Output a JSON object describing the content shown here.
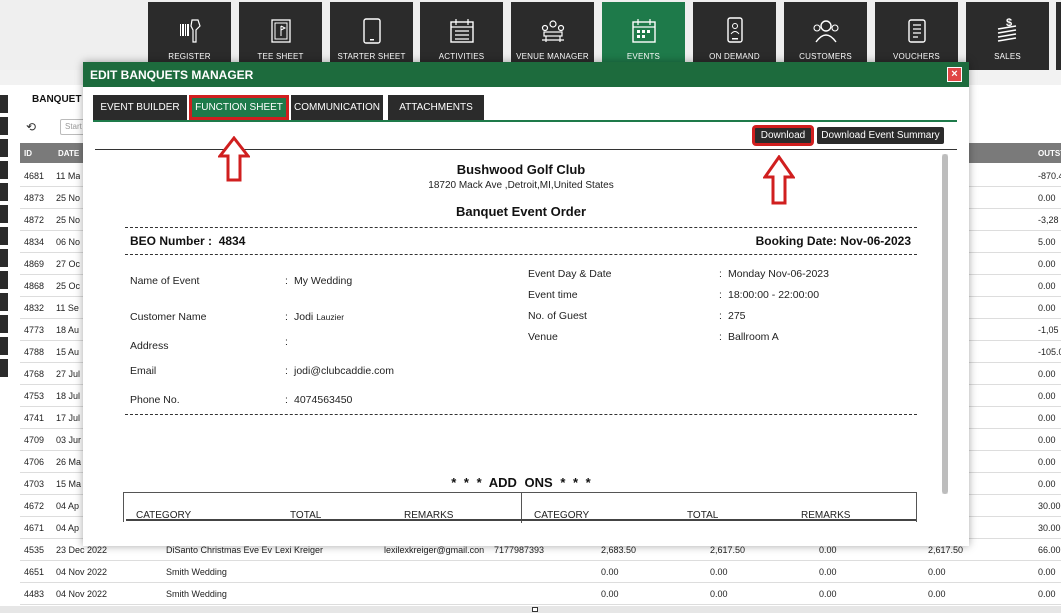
{
  "topnav": {
    "tiles": [
      {
        "label": "REGISTER",
        "icon": "barcode-scanner-icon"
      },
      {
        "label": "TEE SHEET",
        "icon": "tee-sheet-icon"
      },
      {
        "label": "STARTER SHEET",
        "icon": "tablet-icon"
      },
      {
        "label": "ACTIVITIES",
        "icon": "calendar-icon"
      },
      {
        "label": "VENUE MANAGER",
        "icon": "venue-icon"
      },
      {
        "label": "EVENTS",
        "icon": "events-calendar-icon"
      },
      {
        "label": "ON DEMAND",
        "icon": "phone-icon"
      },
      {
        "label": "CUSTOMERS",
        "icon": "customers-icon"
      },
      {
        "label": "VOUCHERS",
        "icon": "voucher-icon"
      },
      {
        "label": "SALES",
        "icon": "sales-icon"
      }
    ],
    "active_color": "#1e7a4a"
  },
  "background": {
    "title": "BANQUET",
    "search_placeholder": "Start",
    "columns": {
      "id": "ID",
      "date": "DATE",
      "outstanding": "OUTST"
    },
    "rows": [
      {
        "id": "4681",
        "date": "11 Ma",
        "out": "-870.4"
      },
      {
        "id": "4873",
        "date": "25 No",
        "out": "0.00"
      },
      {
        "id": "4872",
        "date": "25 No",
        "out": "-3,28"
      },
      {
        "id": "4834",
        "date": "06 No",
        "out": "5.00"
      },
      {
        "id": "4869",
        "date": "27 Oc",
        "out": "0.00"
      },
      {
        "id": "4868",
        "date": "25 Oc",
        "out": "0.00"
      },
      {
        "id": "4832",
        "date": "11 Se",
        "out": "0.00"
      },
      {
        "id": "4773",
        "date": "18 Au",
        "out": "-1,05"
      },
      {
        "id": "4788",
        "date": "15 Au",
        "out": "-105.0"
      },
      {
        "id": "4768",
        "date": "27 Jul",
        "out": "0.00"
      },
      {
        "id": "4753",
        "date": "18 Jul",
        "out": "0.00"
      },
      {
        "id": "4741",
        "date": "17 Jul",
        "out": "0.00"
      },
      {
        "id": "4709",
        "date": "03 Jur",
        "out": "0.00"
      },
      {
        "id": "4706",
        "date": "26 Ma",
        "out": "0.00"
      },
      {
        "id": "4703",
        "date": "15 Ma",
        "out": "0.00"
      },
      {
        "id": "4672",
        "date": "04 Ap",
        "out": "30.00"
      },
      {
        "id": "4671",
        "date": "04 Ap",
        "out": "30.00"
      }
    ],
    "full_rows": [
      {
        "id": "4535",
        "date": "23 Dec 2022",
        "event": "DiSanto Christmas Eve Ev",
        "customer": "Lexi Kreiger",
        "email": "lexilexkreiger@gmail.con",
        "phone": "7177987393",
        "c1": "2,683.50",
        "c2": "2,617.50",
        "c3": "0.00",
        "c4": "2,617.50",
        "out": "66.00"
      },
      {
        "id": "4651",
        "date": "04 Nov 2022",
        "event": "Smith Wedding",
        "customer": "",
        "email": "",
        "phone": "",
        "c1": "0.00",
        "c2": "0.00",
        "c3": "0.00",
        "c4": "0.00",
        "out": "0.00"
      },
      {
        "id": "4483",
        "date": "04 Nov 2022",
        "event": "Smith Wedding",
        "customer": "",
        "email": "",
        "phone": "",
        "c1": "0.00",
        "c2": "0.00",
        "c3": "0.00",
        "c4": "0.00",
        "out": "0.00"
      }
    ]
  },
  "modal": {
    "title": "EDIT BANQUETS MANAGER",
    "close": "×",
    "tabs": [
      "EVENT BUILDER",
      "FUNCTION SHEET",
      "COMMUNICATION",
      "ATTACHMENTS"
    ],
    "active_tab": "FUNCTION SHEET",
    "download_label": "Download",
    "download_summary_label": "Download Event Summary",
    "highlight_color": "#d01f1f"
  },
  "document": {
    "club_name": "Bushwood Golf Club",
    "club_address": "18720 Mack Ave ,Detroit,MI,United States",
    "heading": "Banquet Event Order",
    "beo_label": "BEO Number :",
    "beo_number": "4834",
    "booking_label": "Booking Date:",
    "booking_date": "Nov-06-2023",
    "left_fields": {
      "event_name_label": "Name of Event",
      "event_name": "My Wedding",
      "customer_label": "Customer Name",
      "customer_first": "Jodi",
      "customer_last": "Lauzier",
      "address_label": "Address",
      "address": "",
      "email_label": "Email",
      "email": "jodi@clubcaddie.com",
      "phone_label": "Phone No.",
      "phone": "4074563450"
    },
    "right_fields": {
      "day_label": "Event Day & Date",
      "day": "Monday Nov-06-2023",
      "time_label": "Event time",
      "time": "18:00:00 - 22:00:00",
      "guests_label": "No. of Guest",
      "guests": "275",
      "venue_label": "Venue",
      "venue": "Ballroom A"
    },
    "addons_title": "* * *    ADD ONS    * * *",
    "addons_columns": [
      "CATEGORY",
      "TOTAL",
      "REMARKS",
      "CATEGORY",
      "TOTAL",
      "REMARKS"
    ]
  }
}
